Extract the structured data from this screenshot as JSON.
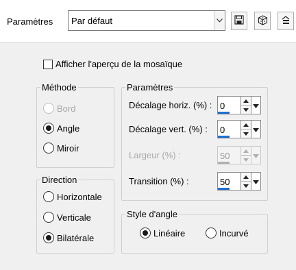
{
  "header": {
    "preset_label": "Paramètres",
    "preset_value": "Par défaut",
    "buttons": [
      {
        "icon": "save-icon"
      },
      {
        "icon": "cube-icon"
      },
      {
        "icon": "edit-icon"
      }
    ]
  },
  "preview_checkbox": {
    "label": "Afficher l'aperçu de la mosaïque",
    "checked": false
  },
  "method": {
    "title": "Méthode",
    "options": [
      {
        "label": "Bord",
        "selected": false,
        "disabled": true
      },
      {
        "label": "Angle",
        "selected": true,
        "disabled": false
      },
      {
        "label": "Miroir",
        "selected": false,
        "disabled": false
      }
    ]
  },
  "direction": {
    "title": "Direction",
    "options": [
      {
        "label": "Horizontale",
        "selected": false
      },
      {
        "label": "Verticale",
        "selected": false
      },
      {
        "label": "Bilatérale",
        "selected": true
      }
    ]
  },
  "params": {
    "title": "Paramètres",
    "fields": [
      {
        "label": "Décalage horiz. (%) :",
        "value": "0",
        "fill": 0.5,
        "disabled": false
      },
      {
        "label": "Décalage vert. (%) :",
        "value": "0",
        "fill": 0.5,
        "disabled": false
      },
      {
        "label": "Largeur (%) :",
        "value": "50",
        "fill": 0.5,
        "disabled": true
      },
      {
        "label": "Transition (%) :",
        "value": "50",
        "fill": 0.5,
        "disabled": false
      }
    ]
  },
  "corner_style": {
    "title": "Style d'angle",
    "options": [
      {
        "label": "Linéaire",
        "selected": true
      },
      {
        "label": "Incurvé",
        "selected": false
      }
    ]
  },
  "colors": {
    "accent": "#1e6fd0",
    "background": "#f0f0f0"
  }
}
